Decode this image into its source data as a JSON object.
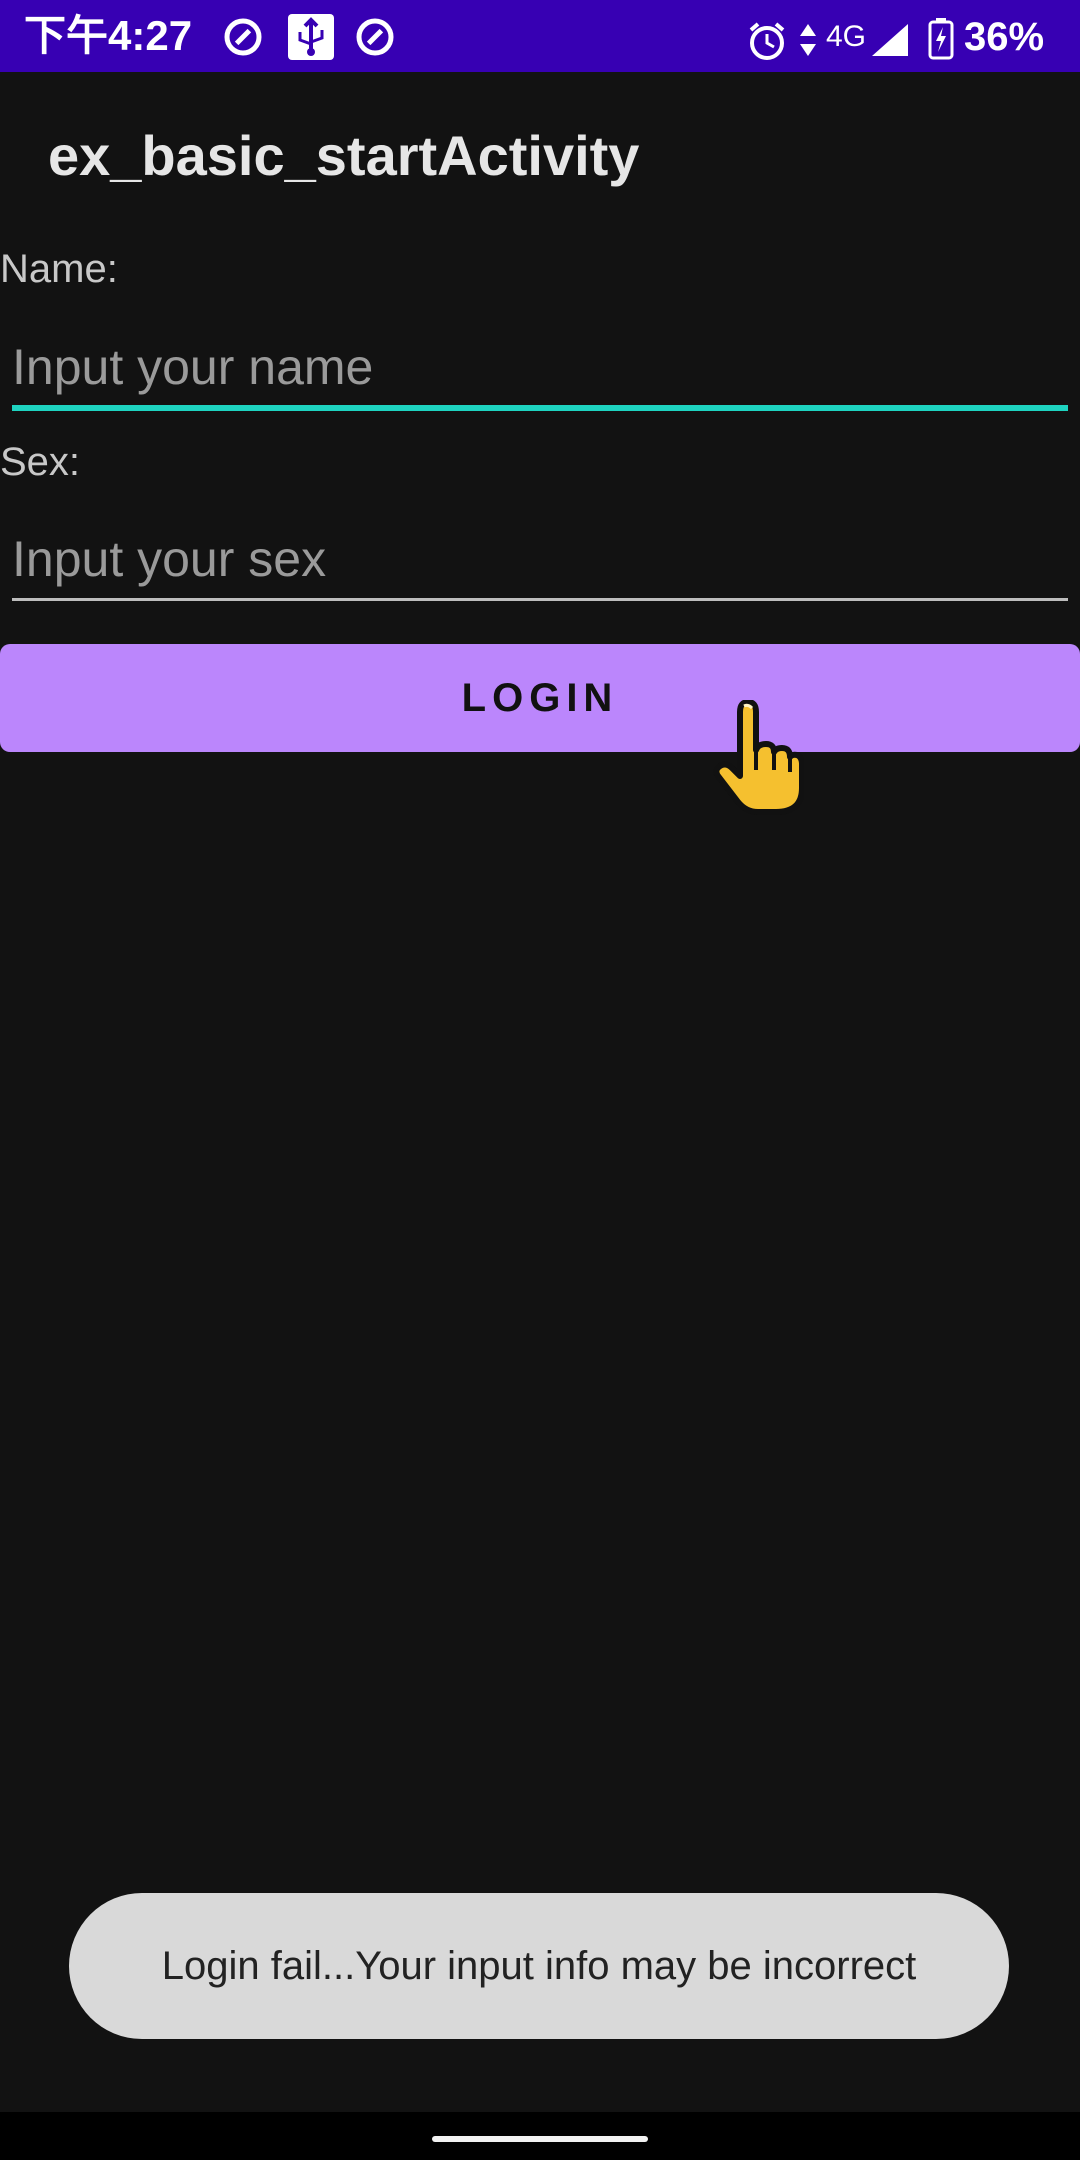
{
  "status_bar": {
    "time": "下午4:27",
    "network": "4G",
    "battery_percent": "36%",
    "left_icons": [
      "vpn-circle-icon",
      "usb-icon",
      "vpn-circle-icon"
    ],
    "right_icons": [
      "alarm-icon",
      "data-arrows-icon",
      "signal-icon",
      "battery-charging-icon"
    ]
  },
  "app": {
    "title": "ex_basic_startActivity"
  },
  "form": {
    "name_label": "Name:",
    "name_placeholder": "Input your name",
    "name_value": "",
    "sex_label": "Sex:",
    "sex_placeholder": "Input your sex",
    "sex_value": "",
    "login_label": "LOGIN"
  },
  "toast": {
    "message": "Login fail...Your input info may be incorrect"
  },
  "colors": {
    "status_bar": "#3700b3",
    "background": "#121212",
    "accent_underline": "#1ed3c0",
    "button": "#bb86fc",
    "toast_bg": "#d9d9d9"
  }
}
